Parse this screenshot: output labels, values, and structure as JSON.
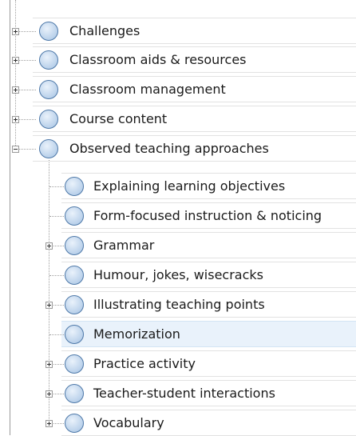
{
  "tree": {
    "top_items": [
      {
        "label": "Challenges",
        "expanded": false
      },
      {
        "label": "Classroom aids & resources",
        "expanded": false
      },
      {
        "label": "Classroom management",
        "expanded": false
      },
      {
        "label": "Course content",
        "expanded": false
      },
      {
        "label": "Observed teaching approaches",
        "expanded": true
      }
    ],
    "child_items": [
      {
        "label": "Explaining learning objectives",
        "has_children": false
      },
      {
        "label": "Form-focused instruction & noticing",
        "has_children": false
      },
      {
        "label": "Grammar",
        "has_children": true
      },
      {
        "label": "Humour, jokes, wisecracks",
        "has_children": false
      },
      {
        "label": "Illustrating teaching points",
        "has_children": true
      },
      {
        "label": "Memorization",
        "has_children": false,
        "selected": true
      },
      {
        "label": "Practice activity",
        "has_children": true
      },
      {
        "label": "Teacher-student interactions",
        "has_children": true
      },
      {
        "label": "Vocabulary",
        "has_children": true
      }
    ]
  },
  "colors": {
    "selected_row": "#e9f2fb",
    "node_icon": "#b7cfe9",
    "node_border": "#4d78a8"
  }
}
